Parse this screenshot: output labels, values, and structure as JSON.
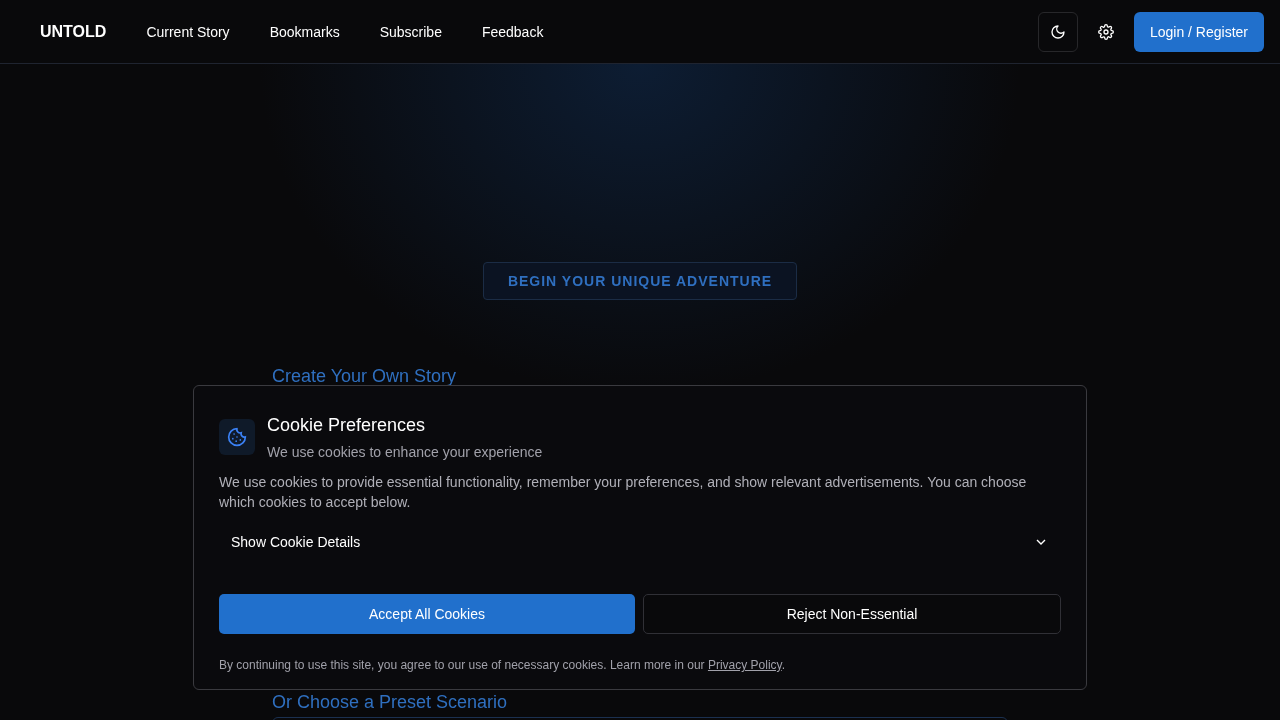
{
  "nav": {
    "logo": "UNTOLD",
    "links": [
      "Current Story",
      "Bookmarks",
      "Subscribe",
      "Feedback"
    ],
    "login": "Login / Register"
  },
  "hero": {
    "badge": "BEGIN YOUR UNIQUE ADVENTURE"
  },
  "sections": [
    "Create Your Own Story",
    "Or Choose a Preset Scenario"
  ],
  "cookie_dialog": {
    "title": "Cookie Preferences",
    "subtitle": "We use cookies to enhance your experience",
    "body": "We use cookies to provide essential functionality, remember your preferences, and show relevant advertisements. You can choose which cookies to accept below.",
    "details": {
      "label": "Show Cookie Details",
      "expanded": false
    },
    "accept": "Accept All Cookies",
    "reject": "Reject Non-Essential",
    "footer": "By continuing to use this site, you agree to our use of necessary cookies. Learn more in our ",
    "footer_link": "Privacy Policy",
    "footer_end": "."
  }
}
